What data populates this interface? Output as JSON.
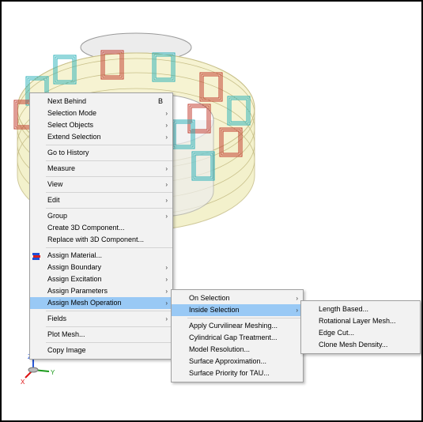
{
  "colors": {
    "menu_bg": "#f2f2f2",
    "highlight": "#99c9f5",
    "ring_fill": "#f2efc4",
    "red_coil": "#c0392b",
    "cyan_coil": "#2ab0b8",
    "axis_x": "#d11",
    "axis_y": "#1a9a1a",
    "axis_z": "#2a5ad8"
  },
  "context_menu": {
    "items": [
      {
        "label": "Next Behind",
        "shortcut": "B"
      },
      {
        "label": "Selection Mode",
        "arrow": true
      },
      {
        "label": "Select Objects",
        "arrow": true
      },
      {
        "label": "Extend Selection",
        "arrow": true
      },
      {
        "sep": true
      },
      {
        "label": "Go to History"
      },
      {
        "sep": true
      },
      {
        "label": "Measure",
        "arrow": true
      },
      {
        "sep": true
      },
      {
        "label": "View",
        "arrow": true
      },
      {
        "sep": true
      },
      {
        "label": "Edit",
        "arrow": true
      },
      {
        "sep": true
      },
      {
        "label": "Group",
        "arrow": true
      },
      {
        "label": "Create 3D Component..."
      },
      {
        "label": "Replace with 3D Component..."
      },
      {
        "sep": true
      },
      {
        "label": "Assign Material...",
        "icon": "material-icon"
      },
      {
        "label": "Assign Boundary",
        "arrow": true
      },
      {
        "label": "Assign Excitation",
        "arrow": true
      },
      {
        "label": "Assign Parameters",
        "arrow": true
      },
      {
        "label": "Assign Mesh Operation",
        "arrow": true,
        "highlighted": true
      },
      {
        "sep": true
      },
      {
        "label": "Fields",
        "arrow": true
      },
      {
        "sep": true
      },
      {
        "label": "Plot Mesh..."
      },
      {
        "sep": true
      },
      {
        "label": "Copy Image"
      }
    ]
  },
  "mesh_submenu": {
    "items": [
      {
        "label": "On Selection",
        "arrow": true
      },
      {
        "label": "Inside Selection",
        "arrow": true,
        "highlighted": true
      },
      {
        "sep": true
      },
      {
        "label": "Apply Curvilinear Meshing..."
      },
      {
        "label": "Cylindrical Gap Treatment..."
      },
      {
        "label": "Model Resolution..."
      },
      {
        "label": "Surface Approximation..."
      },
      {
        "label": "Surface Priority for TAU..."
      }
    ]
  },
  "inside_submenu": {
    "items": [
      {
        "label": "Length Based..."
      },
      {
        "label": "Rotational Layer Mesh..."
      },
      {
        "label": "Edge Cut..."
      },
      {
        "label": "Clone Mesh Density..."
      }
    ]
  },
  "axes": {
    "x": "X",
    "y": "Y",
    "z": "Z"
  }
}
